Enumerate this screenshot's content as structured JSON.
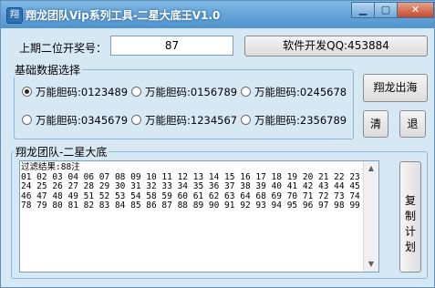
{
  "window": {
    "title": "翔龙团队Vip系列工具-二星大底王V1.0",
    "icon_glyph": "翔"
  },
  "caption_buttons": {
    "min": "▁",
    "max": "▢",
    "close": "✕"
  },
  "top": {
    "period_label": "上期二位开奖号：",
    "period_value": "87",
    "developer_button": "软件开发QQ:453884"
  },
  "basic_group": {
    "title": "基础数据选择",
    "options": [
      {
        "label": "万能胆码:0123489",
        "selected": true
      },
      {
        "label": "万能胆码:0156789",
        "selected": false
      },
      {
        "label": "万能胆码:0245678",
        "selected": false
      },
      {
        "label": "万能胆码:0345679",
        "selected": false
      },
      {
        "label": "万能胆码:1234567",
        "selected": false
      },
      {
        "label": "万能胆码:2356789",
        "selected": false
      }
    ]
  },
  "side_buttons": {
    "xianglong": "翔龙出海",
    "clear": "清",
    "exit": "退"
  },
  "result_group": {
    "title": "翔龙团队-二星大底",
    "lines": [
      "过滤结果:88注",
      "01 02 03 04 06 07 08 09 10 11 12 13 14 15 16 17 18 19 20 21 22 23",
      "24 25 26 27 28 29 30 31 32 33 34 35 36 37 38 39 40 41 42 43 44 45",
      "46 47 48 49 51 52 53 54 58 59 60 61 62 63 64 68 69 70 71 72 73 74",
      "78 79 80 81 82 83 84 85 86 87 88 89 90 91 92 93 94 95 96 97 98 99"
    ],
    "copy_button": [
      "复",
      "制",
      "计",
      "划"
    ]
  },
  "scrollbar": {
    "up": "▲",
    "down": "▼"
  },
  "colors": {
    "titlebar": "#4f93cd",
    "window_bg": "#d7e8f5",
    "group_border": "#8fb6d4"
  }
}
